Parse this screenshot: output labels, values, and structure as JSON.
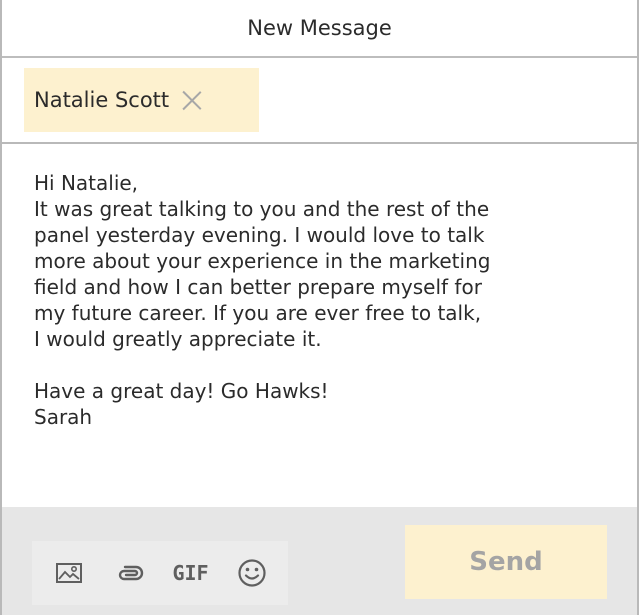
{
  "header": {
    "title": "New Message"
  },
  "recipients": {
    "items": [
      {
        "name": "Natalie Scott"
      }
    ]
  },
  "message": {
    "body": "Hi Natalie,\nIt was great talking to you and the rest of the\npanel yesterday evening. I would love to talk\nmore about your experience in the marketing\nfield and how I can better prepare myself for\nmy future career. If you are ever free to talk,\nI would greatly appreciate it.\n\nHave a great day! Go Hawks!\nSarah"
  },
  "toolbar": {
    "icons": [
      "image-icon",
      "attachment-icon",
      "gif-icon",
      "emoji-icon"
    ],
    "gif_label": "GIF",
    "send_label": "Send"
  },
  "colors": {
    "chip_background": "#fdf1cf",
    "send_background": "#fdf1cf",
    "send_text": "#a4a4a4",
    "toolbar_background": "#e6e6e6"
  }
}
